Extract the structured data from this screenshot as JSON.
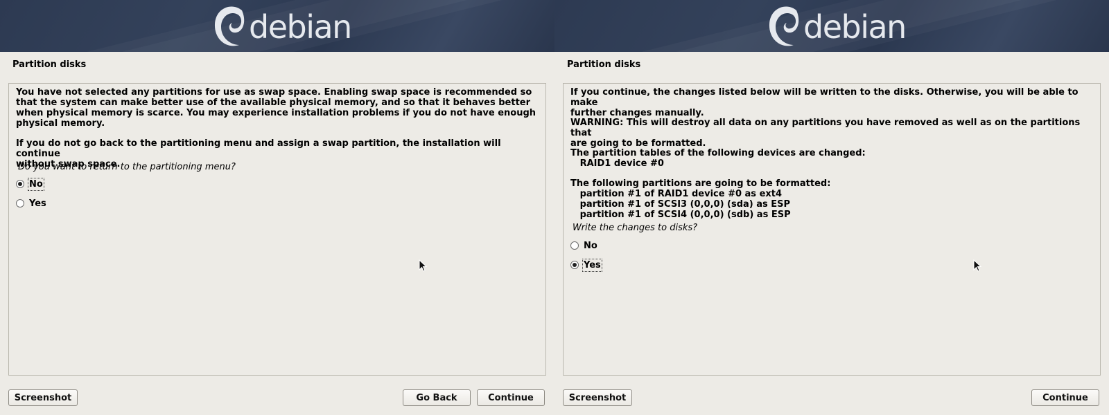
{
  "brand": {
    "logo_text": "debian",
    "banner_color": "#2f3c55",
    "logo_color": "#e6e9ee"
  },
  "left": {
    "step_title": "Partition disks",
    "paragraphs": [
      "You have not selected any partitions for use as swap space. Enabling swap space is recommended so\nthat the system can make better use of the available physical memory, and so that it behaves better\nwhen physical memory is scarce. You may experience installation problems if you do not have enough\nphysical memory.",
      "If you do not go back to the partitioning menu and assign a swap partition, the installation will continue\nwithout swap space."
    ],
    "question": "Do you want to return to the partitioning menu?",
    "options": [
      {
        "label": "No",
        "selected": true
      },
      {
        "label": "Yes",
        "selected": false
      }
    ],
    "buttons": {
      "screenshot": "Screenshot",
      "go_back": "Go Back",
      "continue": "Continue"
    }
  },
  "right": {
    "step_title": "Partition disks",
    "paragraphs": [
      "If you continue, the changes listed below will be written to the disks. Otherwise, you will be able to make\nfurther changes manually.",
      "WARNING: This will destroy all data on any partitions you have removed as well as on the partitions that\nare going to be formatted.",
      "The partition tables of the following devices are changed:\n   RAID1 device #0",
      "The following partitions are going to be formatted:\n   partition #1 of RAID1 device #0 as ext4\n   partition #1 of SCSI3 (0,0,0) (sda) as ESP\n   partition #1 of SCSI4 (0,0,0) (sdb) as ESP"
    ],
    "question": "Write the changes to disks?",
    "options": [
      {
        "label": "No",
        "selected": false
      },
      {
        "label": "Yes",
        "selected": true
      }
    ],
    "buttons": {
      "screenshot": "Screenshot",
      "continue": "Continue"
    }
  }
}
